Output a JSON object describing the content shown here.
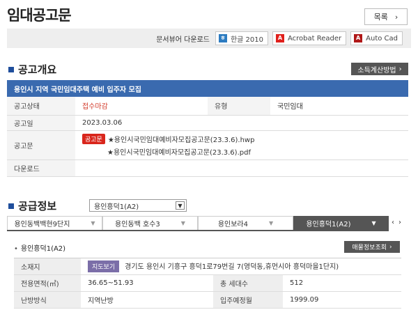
{
  "header": {
    "title": "임대공고문",
    "list_label": "목록",
    "list_icon": "chevron-right-icon"
  },
  "viewer": {
    "label": "문서뷰어 다운로드",
    "buttons": [
      {
        "label": "한글 2010",
        "icon": "hwp-icon",
        "color": "#2d7cc1"
      },
      {
        "label": "Acrobat Reader",
        "icon": "pdf-icon",
        "color": "#e0201c"
      },
      {
        "label": "Auto Cad",
        "icon": "autocad-icon",
        "color": "#b01818"
      }
    ]
  },
  "overview": {
    "section_title": "공고개요",
    "tax_button": "소득계산방법",
    "notice_title": "용인시 지역 국민임대주택 예비 입주자 모집",
    "rows": {
      "status_label": "공고상태",
      "status_value": "접수마감",
      "type_label": "유형",
      "type_value": "국민임대",
      "date_label": "공고일",
      "date_value": "2023.03.06",
      "doc_label": "공고문",
      "doc_badge": "공고문",
      "doc_files": [
        "★용인시국민임대예비자모집공고문(23.3.6).hwp",
        "★용인시국민임대예비자모집공고문(23.3.6).pdf"
      ],
      "download_label": "다운로드"
    }
  },
  "supply": {
    "section_title": "공급정보",
    "selected": "용인흥덕1(A2)",
    "tabs": [
      "용인동백백현9단지",
      "용인동백 호수3",
      "용인보라4",
      "용인흥덕1(A2)"
    ],
    "active_tab": 3,
    "prev_label": "‹",
    "next_label": "›",
    "sub_title": "용인흥덕1(A2)",
    "sale_button": "매물정보조회",
    "detail": {
      "location_label": "소재지",
      "map_button": "지도보기",
      "location_value": "경기도 용인시 기흥구 흥덕1로79번길 7(영덕동,휴먼시아 흥덕마을1단지)",
      "area_label": "전용면적(㎡)",
      "area_value": "36.65~51.93",
      "households_label": "총 세대수",
      "households_value": "512",
      "heating_label": "난방방식",
      "heating_value": "지역난방",
      "movein_label": "입주예정월",
      "movein_value": "1999.09"
    }
  },
  "colors": {
    "notice_bar": "#3a6aaf",
    "status_red": "#d23a2a",
    "section_square": "#1f4e9c",
    "dark_button": "#555555"
  }
}
